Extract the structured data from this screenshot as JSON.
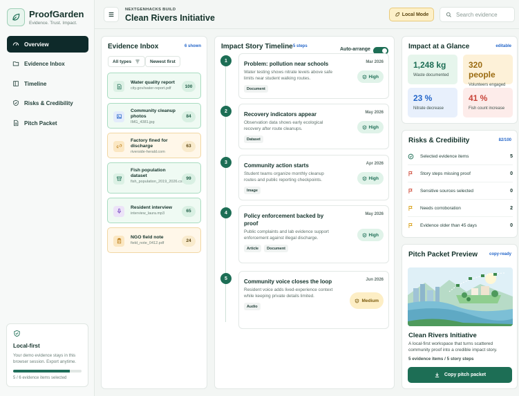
{
  "app": {
    "name": "ProofGarden",
    "tagline": "Evidence. Trust. Impact."
  },
  "nav": [
    {
      "label": "Overview",
      "active": true
    },
    {
      "label": "Evidence Inbox"
    },
    {
      "label": "Timeline"
    },
    {
      "label": "Risks & Credibility"
    },
    {
      "label": "Pitch Packet"
    }
  ],
  "local_first": {
    "title": "Local-first",
    "desc": "Your demo evidence stays in this browser session. Export anytime.",
    "progress": 0.833,
    "status": "5 / 6 evidence items selected"
  },
  "header": {
    "kicker": "NEXTGENHACKS BUILD",
    "title": "Clean Rivers Initiative",
    "local_mode": "Local Mode",
    "search_placeholder": "Search evidence"
  },
  "inbox": {
    "title": "Evidence Inbox",
    "count": "6 shown",
    "filter": "All types",
    "sort": "Newest first",
    "items": [
      {
        "title": "Water quality report",
        "file": "city.gov/water-report.pdf",
        "score": "100",
        "icon": "doc-icon",
        "tone": "g"
      },
      {
        "title": "Community cleanup photos",
        "file": "IMG_4381.jpg",
        "score": "84",
        "icon": "image-icon",
        "tone": "g"
      },
      {
        "title": "Factory fined for discharge",
        "file": "riverside-herald.com",
        "score": "63",
        "icon": "link-icon",
        "tone": "y"
      },
      {
        "title": "Fish population dataset",
        "file": "fish_population_2019_2026.csv",
        "score": "99",
        "icon": "dataset-icon",
        "tone": "g"
      },
      {
        "title": "Resident interview",
        "file": "interview_laura.mp3",
        "score": "65",
        "icon": "mic-icon",
        "tone": "g"
      },
      {
        "title": "NGO field note",
        "file": "field_note_0412.pdf",
        "score": "24",
        "icon": "note-icon",
        "tone": "y"
      }
    ]
  },
  "timeline": {
    "title": "Impact Story Timeline",
    "count": "5 steps",
    "auto_label": "Auto-arrange",
    "steps": [
      {
        "n": "1",
        "title": "Problem: pollution near schools",
        "desc": "Water testing shows nitrate levels above safe limits near student walking routes.",
        "date": "Mar 2026",
        "tags": [
          "Document"
        ],
        "level": "High"
      },
      {
        "n": "2",
        "title": "Recovery indicators appear",
        "desc": "Observation data shows early ecological recovery after route cleanups.",
        "date": "May 2026",
        "tags": [
          "Dataset"
        ],
        "level": "High"
      },
      {
        "n": "3",
        "title": "Community action starts",
        "desc": "Student teams organize monthly cleanup routes and public reporting checkpoints.",
        "date": "Apr 2026",
        "tags": [
          "Image"
        ],
        "level": "High"
      },
      {
        "n": "4",
        "title": "Policy enforcement backed by proof",
        "desc": "Public complaints and lab evidence support enforcement against illegal discharge.",
        "date": "May 2026",
        "tags": [
          "Article",
          "Document"
        ],
        "level": "High"
      },
      {
        "n": "5",
        "title": "Community voice closes the loop",
        "desc": "Resident voice adds lived-experience context while keeping private details limited.",
        "date": "Jun 2026",
        "tags": [
          "Audio"
        ],
        "level": "Medium"
      }
    ]
  },
  "glance": {
    "title": "Impact at a Glance",
    "edit": "editable",
    "tiles": [
      {
        "value": "1,248 kg",
        "label": "Waste documented",
        "bg": "#e6f5ec",
        "fg": "#1d6e55"
      },
      {
        "value": "320 people",
        "label": "Volunteers engaged",
        "bg": "#fdf1d8",
        "fg": "#9a6a10"
      },
      {
        "value": "23 %",
        "label": "Nitrate decrease",
        "bg": "#e8f0fc",
        "fg": "#2466c9"
      },
      {
        "value": "41 %",
        "label": "Fish count increase",
        "bg": "#fdecea",
        "fg": "#c8453a"
      }
    ]
  },
  "risks": {
    "title": "Risks & Credibility",
    "score": "82/100",
    "rows": [
      {
        "label": "Selected evidence items",
        "value": "5",
        "icon": "check-circle-icon",
        "color": "#1d6e55"
      },
      {
        "label": "Story steps missing proof",
        "value": "0",
        "icon": "flag-icon",
        "color": "#d0503f"
      },
      {
        "label": "Sensitive sources selected",
        "value": "0",
        "icon": "flag-icon",
        "color": "#d0503f"
      },
      {
        "label": "Needs corroboration",
        "value": "2",
        "icon": "flag-icon",
        "color": "#d9a21c"
      },
      {
        "label": "Evidence older than 45 days",
        "value": "0",
        "icon": "flag-icon",
        "color": "#d9a21c"
      }
    ]
  },
  "pitch": {
    "title": "Pitch Packet Preview",
    "status": "copy-ready",
    "name": "Clean Rivers Initiative",
    "desc": "A local-first workspace that turns scattered community proof into a credible impact story.",
    "meta": "5 evidence items / 5 story steps",
    "button": "Copy pitch packet"
  }
}
